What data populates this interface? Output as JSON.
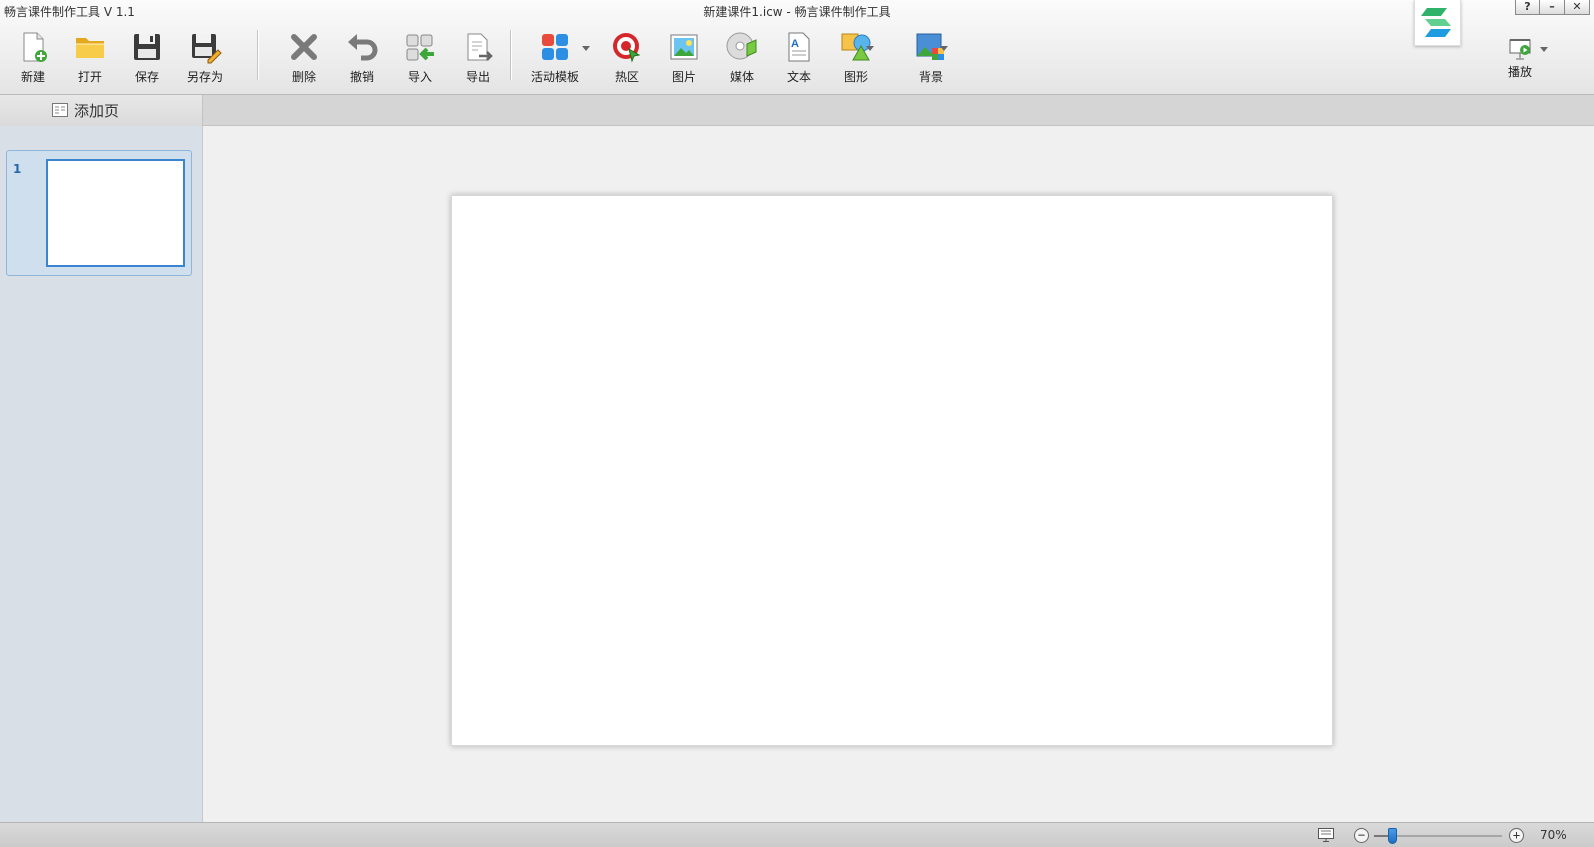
{
  "window": {
    "app_title": "畅言课件制作工具 V 1.1",
    "document_title": "新建课件1.icw - 畅言课件制作工具",
    "controls": {
      "help": "?",
      "minimize": "–",
      "close": "✕"
    }
  },
  "toolbar": {
    "new": "新建",
    "open": "打开",
    "save": "保存",
    "save_as": "另存为",
    "delete": "删除",
    "undo": "撤销",
    "import": "导入",
    "export": "导出",
    "activity_template": "活动模板",
    "hotspot": "热区",
    "image": "图片",
    "media": "媒体",
    "text": "文本",
    "shape": "图形",
    "background": "背景",
    "play": "播放"
  },
  "subbar": {
    "add_page": "添加页"
  },
  "pages": [
    {
      "number": "1"
    }
  ],
  "status": {
    "zoom_label": "70%",
    "zoom_fraction": 0.14
  },
  "colors": {
    "accent": "#1d6fc3",
    "selection": "#3a85d0",
    "panel": "#d8dfe7"
  }
}
